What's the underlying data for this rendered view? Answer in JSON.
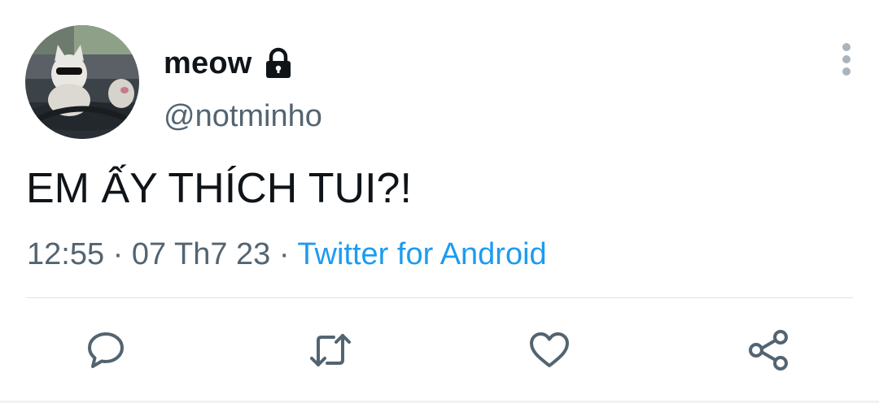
{
  "tweet": {
    "display_name": "meow",
    "handle": "@notminho",
    "text": "EM ẤY THÍCH TUI?!",
    "time": "12:55",
    "date": "07 Th7 23",
    "separator": "·",
    "source": "Twitter for Android"
  },
  "icons": {
    "lock": "lock-icon",
    "more": "more-vertical-icon",
    "reply": "reply-icon",
    "retweet": "retweet-icon",
    "like": "heart-icon",
    "share": "share-icon"
  },
  "colors": {
    "text": "#0f1419",
    "secondary": "#536471",
    "link": "#1d9bf0",
    "icon": "#536471"
  }
}
